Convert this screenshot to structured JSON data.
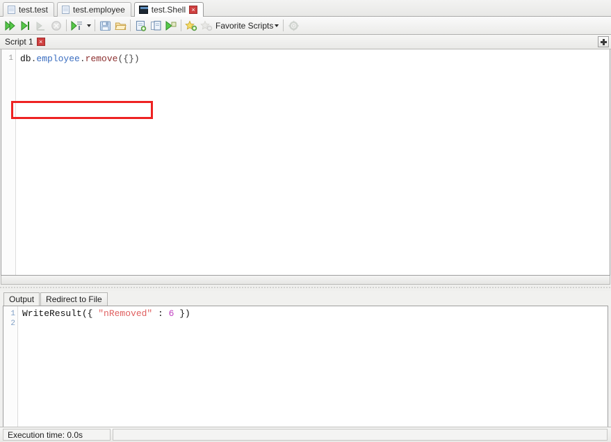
{
  "window": {
    "tabs": [
      {
        "label": "test.test",
        "icon": "document-icon",
        "active": false,
        "closable": false
      },
      {
        "label": "test.employee",
        "icon": "document-icon",
        "active": false,
        "closable": false
      },
      {
        "label": "test.Shell",
        "icon": "shell-icon",
        "active": true,
        "closable": true,
        "close_label": "×"
      }
    ]
  },
  "toolbar": {
    "buttons": [
      {
        "name": "execute-all-button",
        "icon": "double-play-icon",
        "enabled": true
      },
      {
        "name": "execute-button",
        "icon": "play-to-line-icon",
        "enabled": true
      },
      {
        "name": "stop-button",
        "icon": "stop-play-icon",
        "enabled": false
      },
      {
        "name": "cancel-button",
        "icon": "cancel-circle-icon",
        "enabled": false
      },
      {
        "name": "execute-mode-button",
        "icon": "play-list-icon",
        "enabled": true,
        "has_dropdown": true
      },
      {
        "name": "save-script-button",
        "icon": "floppy-save-icon",
        "enabled": true
      },
      {
        "name": "open-script-button",
        "icon": "folder-open-icon",
        "enabled": true
      },
      {
        "name": "new-query-button",
        "icon": "new-document-icon",
        "enabled": true
      },
      {
        "name": "duplicate-query-button",
        "icon": "copy-documents-icon",
        "enabled": true
      },
      {
        "name": "run-query-button",
        "icon": "green-flag-play-icon",
        "enabled": true
      },
      {
        "name": "add-favorite-button",
        "icon": "star-add-icon",
        "enabled": true
      },
      {
        "name": "remove-favorite-button",
        "icon": "star-remove-icon",
        "enabled": false
      },
      {
        "name": "settings-button",
        "icon": "gear-icon",
        "enabled": false
      }
    ],
    "favorite_scripts_label": "Favorite Scripts"
  },
  "script_tabs": {
    "items": [
      {
        "label": "Script 1",
        "close_label": "×",
        "active": true
      }
    ],
    "add_button_icon": "plus-icon"
  },
  "editor": {
    "line_numbers": [
      "1"
    ],
    "code_tokens": [
      {
        "text": "db",
        "type": "plain"
      },
      {
        "text": ".",
        "type": "punct"
      },
      {
        "text": "employee",
        "type": "collection"
      },
      {
        "text": ".",
        "type": "punct"
      },
      {
        "text": "remove",
        "type": "function"
      },
      {
        "text": "({})",
        "type": "punct"
      }
    ],
    "code_plain": "db.employee.remove({})",
    "annotation": {
      "type": "red-rectangle",
      "color": "#ee2222"
    }
  },
  "output": {
    "tabs": [
      {
        "label": "Output",
        "active": true
      },
      {
        "label": "Redirect to File",
        "active": false
      }
    ],
    "line_numbers": [
      "1",
      "2"
    ],
    "result_tokens": [
      {
        "text": "WriteResult({ ",
        "type": "plain"
      },
      {
        "text": "\"nRemoved\"",
        "type": "string"
      },
      {
        "text": " : ",
        "type": "plain"
      },
      {
        "text": "6",
        "type": "number"
      },
      {
        "text": " })",
        "type": "plain"
      }
    ],
    "result_plain": "WriteResult({ \"nRemoved\" : 6 })"
  },
  "statusbar": {
    "execution_time": "Execution time: 0.0s"
  },
  "colors": {
    "accent_red": "#ee2222",
    "collection_blue": "#3b6ec0",
    "function_maroon": "#8c2f2f",
    "string_red": "#e06060",
    "number_magenta": "#c040c0"
  }
}
